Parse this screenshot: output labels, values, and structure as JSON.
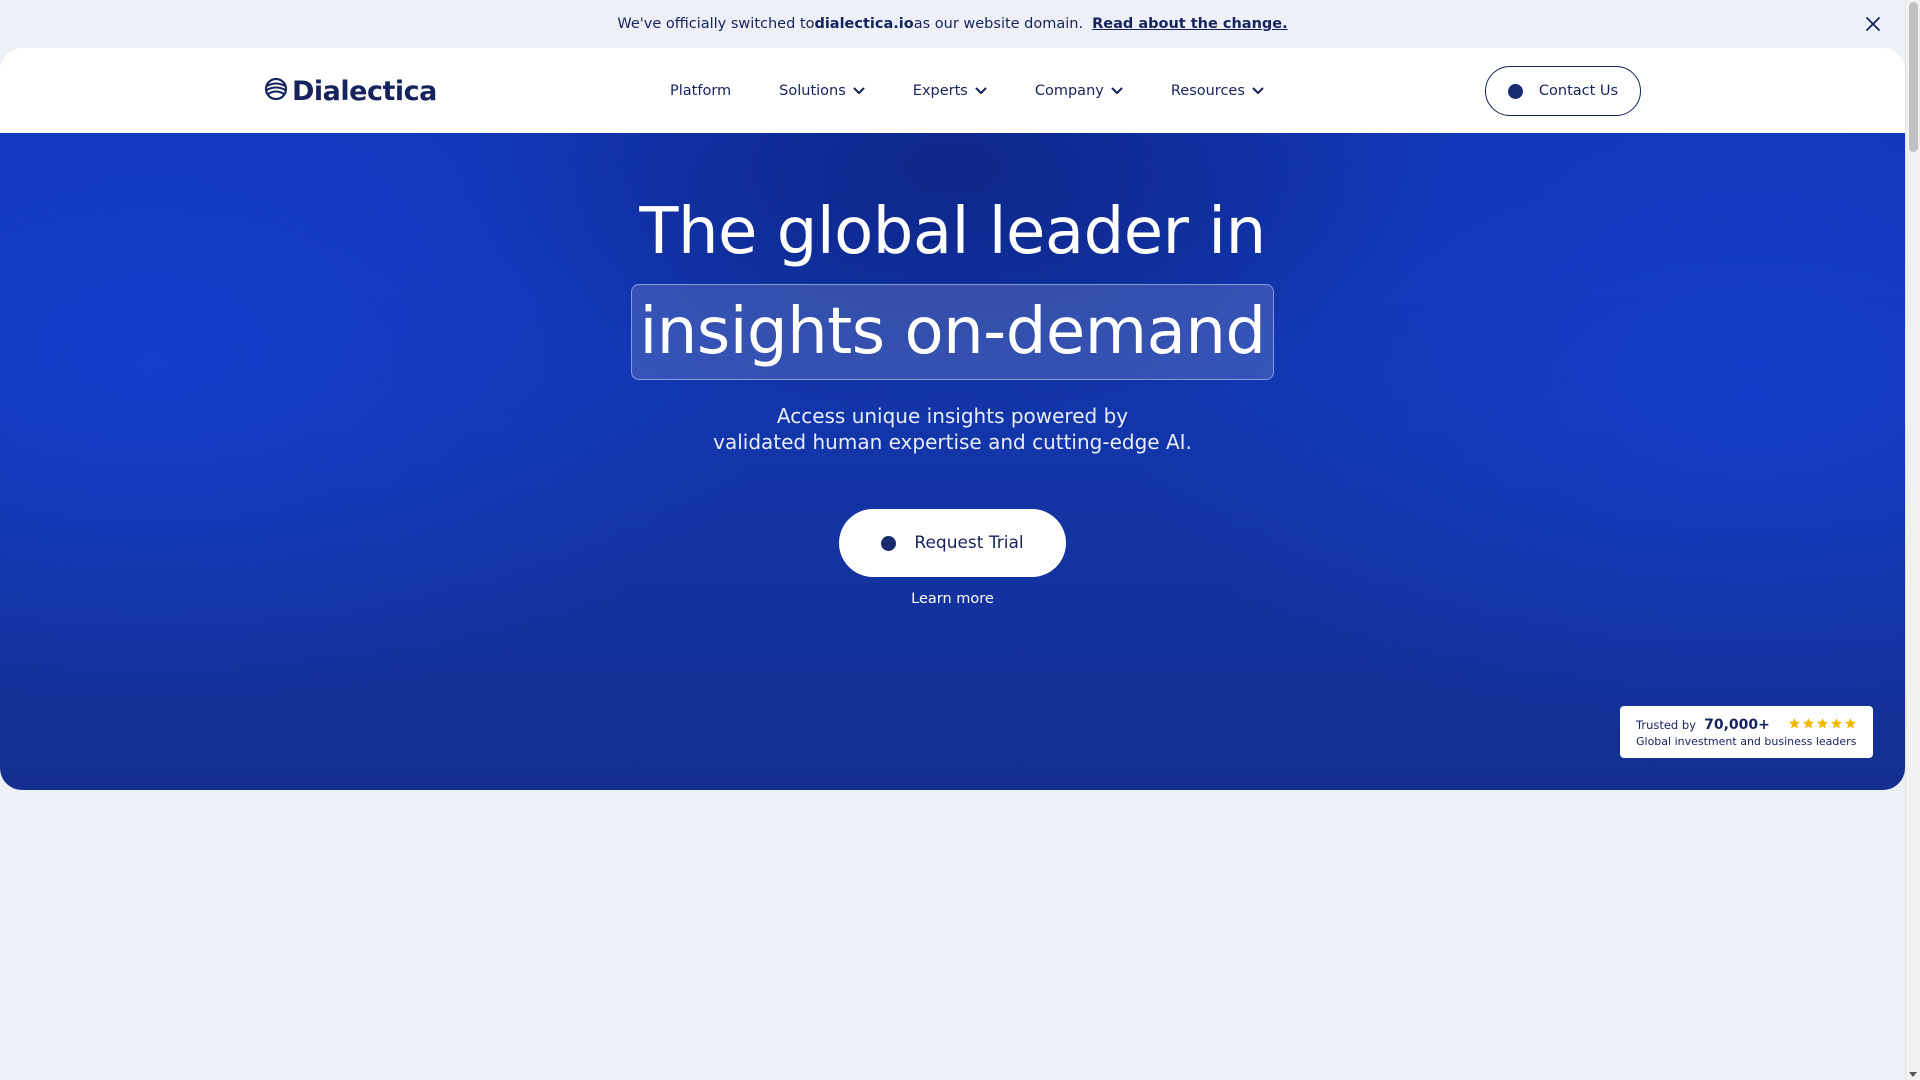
{
  "announcement": {
    "prefix": "We've officially switched to ",
    "domain": "dialectica.io",
    "suffix": " as our website domain.",
    "link": "Read about the change."
  },
  "brand": {
    "name": "Dialectica",
    "color": "#16235c"
  },
  "nav": {
    "items": [
      {
        "label": "Platform",
        "has_dropdown": false
      },
      {
        "label": "Solutions",
        "has_dropdown": true
      },
      {
        "label": "Experts",
        "has_dropdown": true
      },
      {
        "label": "Company",
        "has_dropdown": true
      },
      {
        "label": "Resources",
        "has_dropdown": true
      }
    ],
    "contact_label": "Contact Us"
  },
  "hero": {
    "title_line1": "The global leader in",
    "title_line2": "insights on-demand",
    "subtitle_line1": "Access unique insights powered by",
    "subtitle_line2": "validated human expertise and cutting-edge AI.",
    "cta_label": "Request Trial",
    "secondary_label": "Learn more",
    "accent": "#1236ac"
  },
  "trust": {
    "label": "Trusted by",
    "count": "70,000+",
    "description": "Global investment and business leaders",
    "stars": 5,
    "star_color": "#f5b800"
  }
}
